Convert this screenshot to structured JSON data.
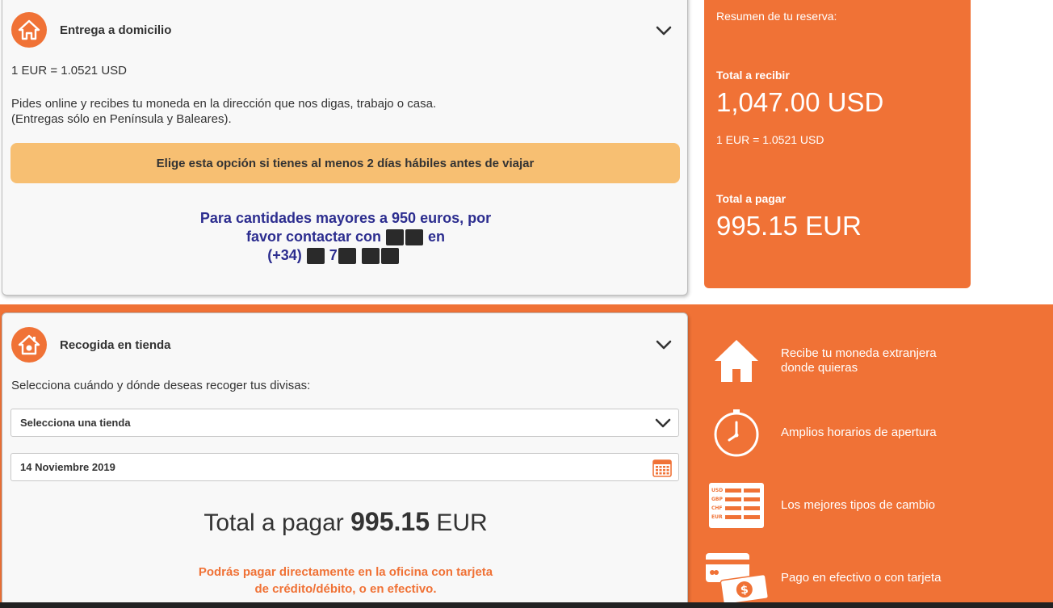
{
  "delivery": {
    "title": "Entrega a domicilio",
    "icon": "home-icon",
    "rate": "1 EUR = 1.0521 USD",
    "desc_line1": "Pides online y recibes tu moneda en la dirección que nos digas, trabajo o casa.",
    "desc_line2": "(Entregas sólo en Península y Baleares).",
    "notice": "Elige esta opción si tienes al menos 2 días hábiles antes de viajar",
    "contact_line1": "Para cantidades mayores a 950 euros, por",
    "contact_line2a": "favor contactar con",
    "contact_line2b": "en",
    "contact_line3a": "(+34)",
    "contact_line3b": "7"
  },
  "summary": {
    "title": "Resumen de tu reserva:",
    "receive_label": "Total a recibir",
    "receive_value": "1,047.00 USD",
    "rate": "1 EUR = 1.0521 USD",
    "pay_label": "Total a pagar",
    "pay_value": "995.15 EUR"
  },
  "pickup": {
    "title": "Recogida en tienda",
    "icon": "store-icon",
    "instruction": "Selecciona cuándo y dónde deseas recoger tus divisas:",
    "store_select": "Selecciona una tienda",
    "date_value": "14 Noviembre 2019",
    "total_prefix": "Total a pagar",
    "total_amount": "995.15",
    "total_currency": "EUR",
    "pay_note_line1": "Podrás pagar directamente en la oficina con tarjeta",
    "pay_note_line2": "de crédito/débito, o en efectivo."
  },
  "features": [
    {
      "icon": "house-icon",
      "text": "Recibe tu moneda extranjera donde quieras"
    },
    {
      "icon": "clock-icon",
      "text": "Amplios horarios de apertura"
    },
    {
      "icon": "exchange-rates-icon",
      "text": "Los mejores tipos de cambio"
    },
    {
      "icon": "cash-card-icon",
      "text": "Pago en efectivo o con tarjeta"
    }
  ],
  "exchange_icon_labels": [
    "USD",
    "GBP",
    "CHF",
    "EUR"
  ],
  "colors": {
    "accent": "#f07236",
    "notice": "#f7bf72",
    "contact": "#2c2d8f"
  }
}
